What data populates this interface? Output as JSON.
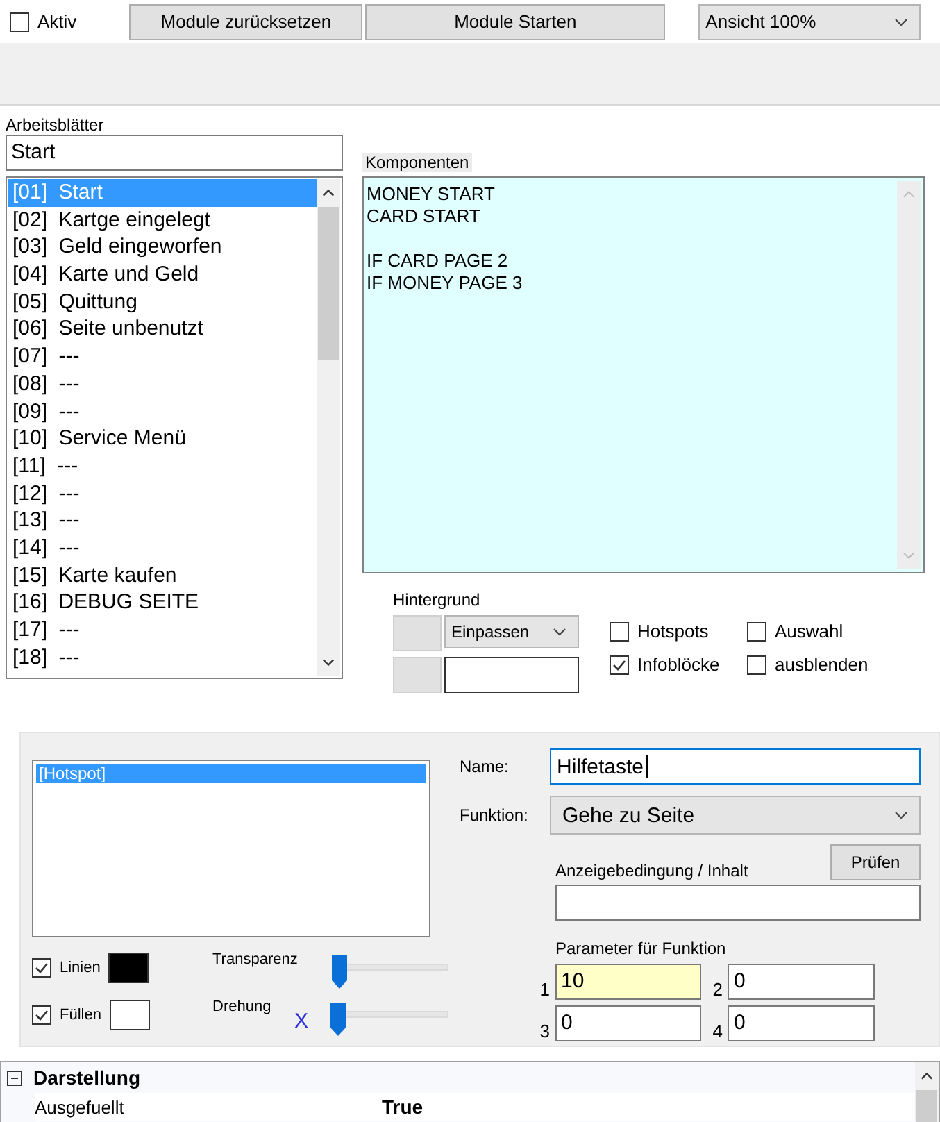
{
  "toolbar": {
    "active": {
      "label": "Aktiv",
      "checked": false
    },
    "buttons": [
      "Module zurücksetzen",
      "Module Starten"
    ],
    "view_select": {
      "value": "Ansicht 100%"
    }
  },
  "worksheets": {
    "label": "Arbeitsblätter",
    "name_value": "Start",
    "items": [
      {
        "number": "[01]",
        "name": "Start",
        "selected": true
      },
      {
        "number": "[02]",
        "name": "Kartge eingelegt",
        "selected": false
      },
      {
        "number": "[03]",
        "name": "Geld eingeworfen",
        "selected": false
      },
      {
        "number": "[04]",
        "name": "Karte und Geld",
        "selected": false
      },
      {
        "number": "[05]",
        "name": "Quittung",
        "selected": false
      },
      {
        "number": "[06]",
        "name": "Seite unbenutzt",
        "selected": false
      },
      {
        "number": "[07]",
        "name": "---",
        "selected": false
      },
      {
        "number": "[08]",
        "name": "---",
        "selected": false
      },
      {
        "number": "[09]",
        "name": "---",
        "selected": false
      },
      {
        "number": "[10]",
        "name": "Service Menü",
        "selected": false
      },
      {
        "number": "[11]",
        "name": "---",
        "selected": false
      },
      {
        "number": "[12]",
        "name": "---",
        "selected": false
      },
      {
        "number": "[13]",
        "name": "---",
        "selected": false
      },
      {
        "number": "[14]",
        "name": "---",
        "selected": false
      },
      {
        "number": "[15]",
        "name": "Karte kaufen",
        "selected": false
      },
      {
        "number": "[16]",
        "name": "DEBUG SEITE",
        "selected": false
      },
      {
        "number": "[17]",
        "name": "---",
        "selected": false
      },
      {
        "number": "[18]",
        "name": "---",
        "selected": false
      }
    ]
  },
  "components": {
    "label": "Komponenten",
    "value": "MONEY START\nCARD START\n\nIF CARD PAGE 2\nIF MONEY PAGE 3"
  },
  "background": {
    "label": "Hintergrund",
    "fit_select": "Einpassen",
    "checkboxes": [
      {
        "label": "Hotspots",
        "checked": false
      },
      {
        "label": "Auswahl",
        "checked": false
      },
      {
        "label": "Infoblöcke",
        "checked": true
      },
      {
        "label": "ausblenden",
        "checked": false
      }
    ]
  },
  "hotspots": {
    "items": [
      {
        "label": "[Hotspot]",
        "selected": true
      }
    ]
  },
  "swatches": [
    {
      "label": "Linien",
      "checked": true,
      "color": "#000000"
    },
    {
      "label": "Füllen",
      "checked": true,
      "color": "#ffffff"
    }
  ],
  "sliders": [
    {
      "label": "Transparenz",
      "level": 0
    },
    {
      "label": "Drehung",
      "marker": "X",
      "level": 0
    }
  ],
  "hotspot_props": {
    "name_label": "Name:",
    "name_value": "Hilfetaste",
    "name_focused": true,
    "function_label": "Funktion:",
    "function_value": "Gehe zu Seite",
    "condition_label": "Anzeigebedingung / Inhalt",
    "check_button": "Prüfen",
    "params_label": "Parameter für Funktion",
    "params": [
      {
        "index": "1",
        "value": "10",
        "highlighted": true
      },
      {
        "index": "2",
        "value": "0",
        "highlighted": false
      },
      {
        "index": "3",
        "value": "0",
        "highlighted": false
      },
      {
        "index": "4",
        "value": "0",
        "highlighted": false
      }
    ]
  },
  "property_grid": {
    "categories": [
      {
        "label": "Darstellung",
        "expanded": true,
        "rows": [
          {
            "name": "Ausgefuellt",
            "value": "True"
          }
        ]
      }
    ]
  }
}
